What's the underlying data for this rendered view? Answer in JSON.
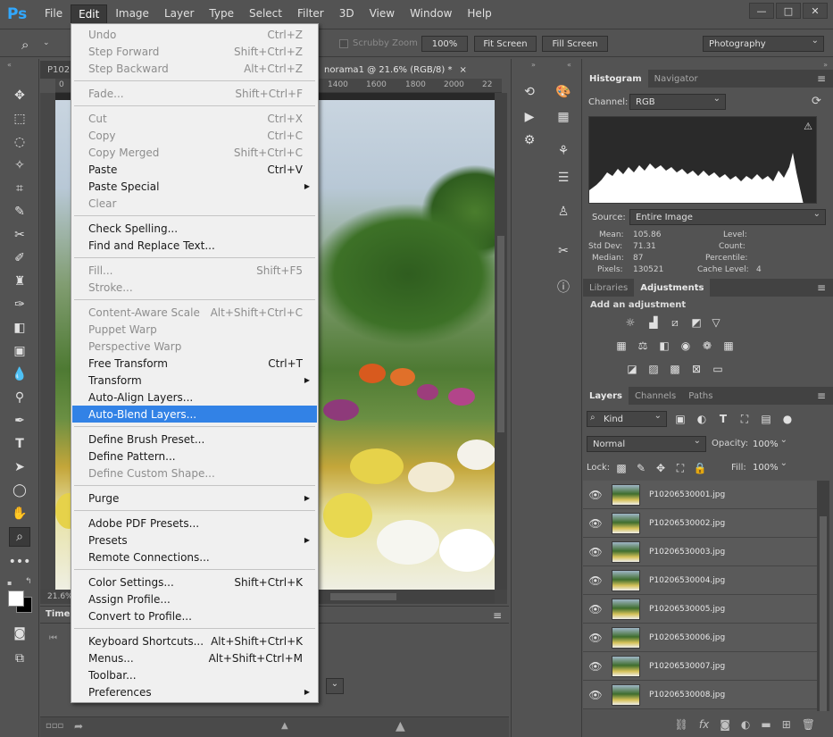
{
  "app": {
    "logo": "Ps",
    "menubar": [
      "File",
      "Edit",
      "Image",
      "Layer",
      "Type",
      "Select",
      "Filter",
      "3D",
      "View",
      "Window",
      "Help"
    ],
    "active_menu": "Edit",
    "window_controls": [
      "—",
      "□",
      "✕"
    ]
  },
  "options_bar": {
    "scrubby_zoom": "Scrubby Zoom",
    "zoom_100": "100%",
    "fit_screen": "Fit Screen",
    "fill_screen": "Fill Screen",
    "workspace": "Photography"
  },
  "document": {
    "tab_left": "P102",
    "tab_active": "norama1 @ 21.6% (RGB/8) *",
    "tab_close": "×",
    "ruler_nums": [
      "0",
      "1400",
      "1600",
      "1800",
      "2000",
      "22"
    ],
    "zoom_status": "21.6%"
  },
  "timeline": {
    "title": "Timel"
  },
  "edit_menu": {
    "items": [
      {
        "label": "Undo",
        "shortcut": "Ctrl+Z",
        "disabled": true
      },
      {
        "label": "Step Forward",
        "shortcut": "Shift+Ctrl+Z",
        "disabled": true
      },
      {
        "label": "Step Backward",
        "shortcut": "Alt+Ctrl+Z",
        "disabled": true
      },
      {
        "sep": true
      },
      {
        "label": "Fade...",
        "shortcut": "Shift+Ctrl+F",
        "disabled": true
      },
      {
        "sep": true
      },
      {
        "label": "Cut",
        "shortcut": "Ctrl+X",
        "disabled": true
      },
      {
        "label": "Copy",
        "shortcut": "Ctrl+C",
        "disabled": true
      },
      {
        "label": "Copy Merged",
        "shortcut": "Shift+Ctrl+C",
        "disabled": true
      },
      {
        "label": "Paste",
        "shortcut": "Ctrl+V",
        "disabled": false
      },
      {
        "label": "Paste Special",
        "shortcut": "",
        "submenu": true,
        "disabled": false
      },
      {
        "label": "Clear",
        "shortcut": "",
        "disabled": true
      },
      {
        "sep": true
      },
      {
        "label": "Check Spelling...",
        "shortcut": "",
        "disabled": false
      },
      {
        "label": "Find and Replace Text...",
        "shortcut": "",
        "disabled": false
      },
      {
        "sep": true
      },
      {
        "label": "Fill...",
        "shortcut": "Shift+F5",
        "disabled": true
      },
      {
        "label": "Stroke...",
        "shortcut": "",
        "disabled": true
      },
      {
        "sep": true
      },
      {
        "label": "Content-Aware Scale",
        "shortcut": "Alt+Shift+Ctrl+C",
        "disabled": true
      },
      {
        "label": "Puppet Warp",
        "shortcut": "",
        "disabled": true
      },
      {
        "label": "Perspective Warp",
        "shortcut": "",
        "disabled": true
      },
      {
        "label": "Free Transform",
        "shortcut": "Ctrl+T",
        "disabled": false
      },
      {
        "label": "Transform",
        "shortcut": "",
        "submenu": true,
        "disabled": false
      },
      {
        "label": "Auto-Align Layers...",
        "shortcut": "",
        "disabled": false
      },
      {
        "label": "Auto-Blend Layers...",
        "shortcut": "",
        "disabled": false,
        "highlight": true
      },
      {
        "sep": true
      },
      {
        "label": "Define Brush Preset...",
        "shortcut": "",
        "disabled": false
      },
      {
        "label": "Define Pattern...",
        "shortcut": "",
        "disabled": false
      },
      {
        "label": "Define Custom Shape...",
        "shortcut": "",
        "disabled": true
      },
      {
        "sep": true
      },
      {
        "label": "Purge",
        "shortcut": "",
        "submenu": true,
        "disabled": false
      },
      {
        "sep": true
      },
      {
        "label": "Adobe PDF Presets...",
        "shortcut": "",
        "disabled": false
      },
      {
        "label": "Presets",
        "shortcut": "",
        "submenu": true,
        "disabled": false
      },
      {
        "label": "Remote Connections...",
        "shortcut": "",
        "disabled": false
      },
      {
        "sep": true
      },
      {
        "label": "Color Settings...",
        "shortcut": "Shift+Ctrl+K",
        "disabled": false
      },
      {
        "label": "Assign Profile...",
        "shortcut": "",
        "disabled": false
      },
      {
        "label": "Convert to Profile...",
        "shortcut": "",
        "disabled": false
      },
      {
        "sep": true
      },
      {
        "label": "Keyboard Shortcuts...",
        "shortcut": "Alt+Shift+Ctrl+K",
        "disabled": false
      },
      {
        "label": "Menus...",
        "shortcut": "Alt+Shift+Ctrl+M",
        "disabled": false
      },
      {
        "label": "Toolbar...",
        "shortcut": "",
        "disabled": false
      },
      {
        "label": "Preferences",
        "shortcut": "",
        "submenu": true,
        "disabled": false
      }
    ]
  },
  "histogram": {
    "tabs": [
      "Histogram",
      "Navigator"
    ],
    "channel_label": "Channel:",
    "channel_value": "RGB",
    "source_label": "Source:",
    "source_value": "Entire Image",
    "stats": {
      "mean_label": "Mean:",
      "mean": "105.86",
      "std_label": "Std Dev:",
      "std": "71.31",
      "median_label": "Median:",
      "median": "87",
      "pixels_label": "Pixels:",
      "pixels": "130521",
      "level_label": "Level:",
      "level": "",
      "count_label": "Count:",
      "count": "",
      "percentile_label": "Percentile:",
      "percentile": "",
      "cache_label": "Cache Level:",
      "cache": "4"
    }
  },
  "adjustments": {
    "tabs": [
      "Libraries",
      "Adjustments"
    ],
    "title": "Add an adjustment"
  },
  "layers": {
    "tabs": [
      "Layers",
      "Channels",
      "Paths"
    ],
    "kind_label": "Kind",
    "blend_mode": "Normal",
    "opacity_label": "Opacity:",
    "opacity": "100%",
    "lock_label": "Lock:",
    "fill_label": "Fill:",
    "fill": "100%",
    "items": [
      "P10206530001.jpg",
      "P10206530002.jpg",
      "P10206530003.jpg",
      "P10206530004.jpg",
      "P10206530005.jpg",
      "P10206530006.jpg",
      "P10206530007.jpg",
      "P10206530008.jpg"
    ]
  },
  "colors": {
    "accent": "#31a8ff",
    "highlight": "#3282e6"
  }
}
